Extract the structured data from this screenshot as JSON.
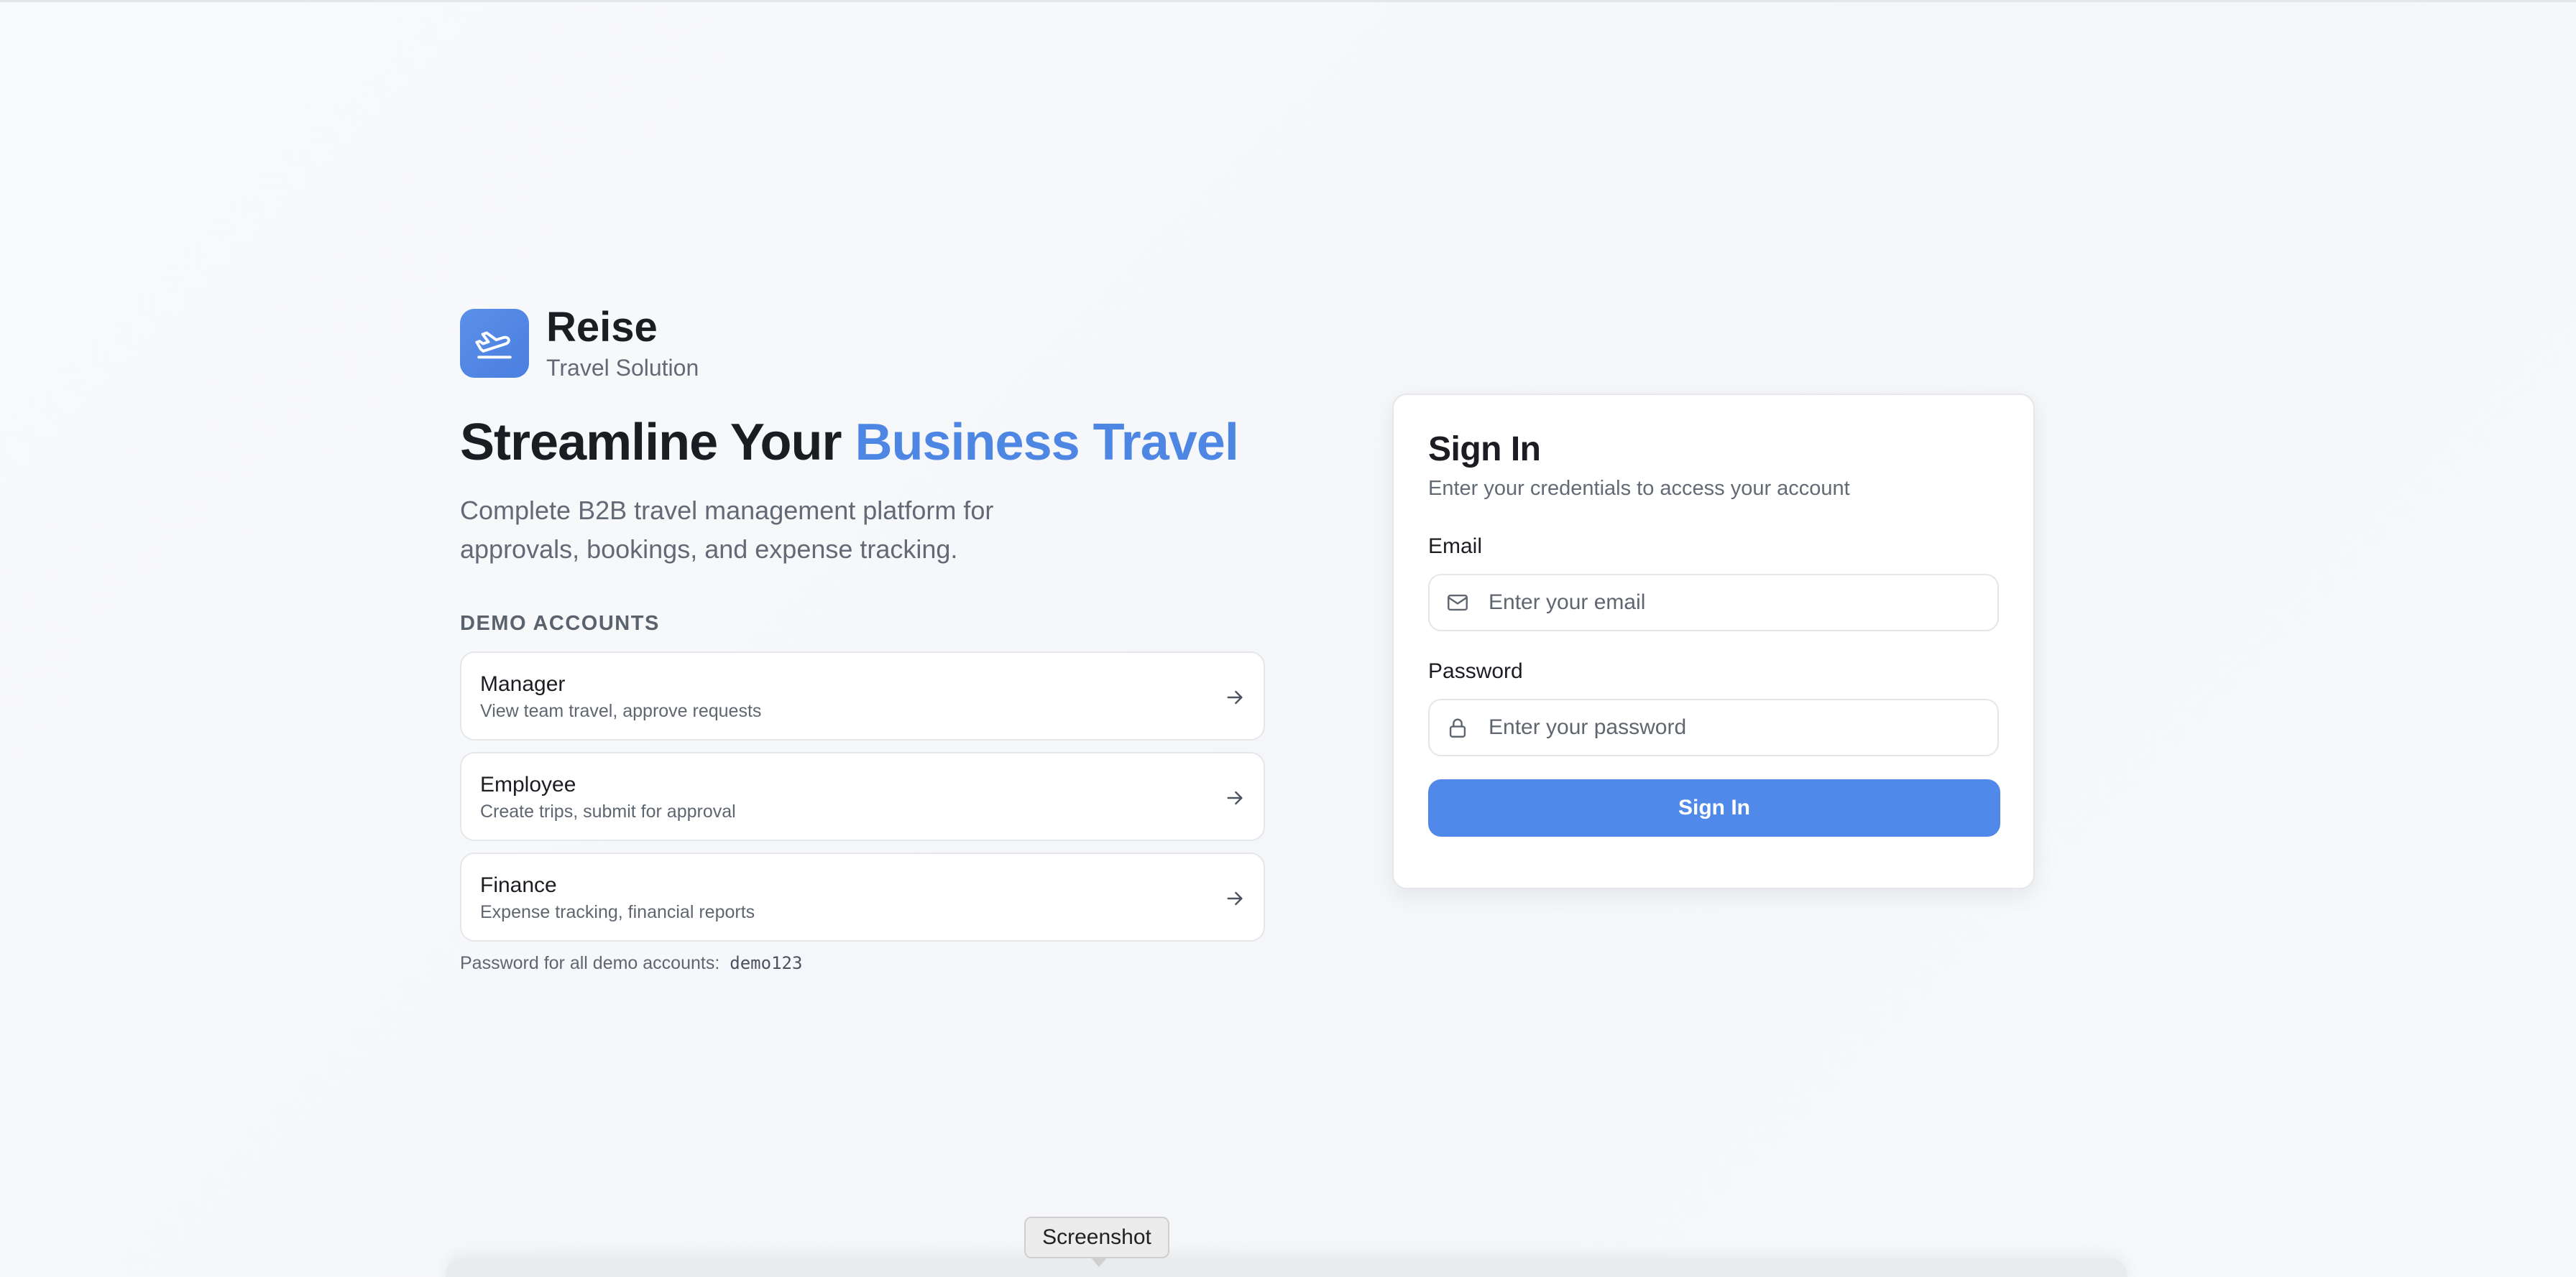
{
  "brand": {
    "name": "Reise",
    "tagline": "Travel Solution",
    "logo_icon": "plane-takeoff-icon",
    "accent_color": "#4e86e4"
  },
  "hero": {
    "headline_prefix": "Streamline Your ",
    "headline_accent": "Business Travel",
    "description": "Complete B2B travel management platform for approvals, bookings, and expense tracking."
  },
  "demo": {
    "title": "DEMO ACCOUNTS",
    "accounts": [
      {
        "name": "Manager",
        "description": "View team travel, approve requests"
      },
      {
        "name": "Employee",
        "description": "Create trips, submit for approval"
      },
      {
        "name": "Finance",
        "description": "Expense tracking, financial reports"
      }
    ],
    "password_note": "Password for all demo accounts:",
    "password": "demo123"
  },
  "signin": {
    "title": "Sign In",
    "subtitle": "Enter your credentials to access your account",
    "email_label": "Email",
    "email_placeholder": "Enter your email",
    "email_value": "",
    "password_label": "Password",
    "password_placeholder": "Enter your password",
    "password_value": "",
    "button_label": "Sign In",
    "button_color": "#5189ea"
  },
  "tooltip": {
    "label": "Screenshot"
  }
}
